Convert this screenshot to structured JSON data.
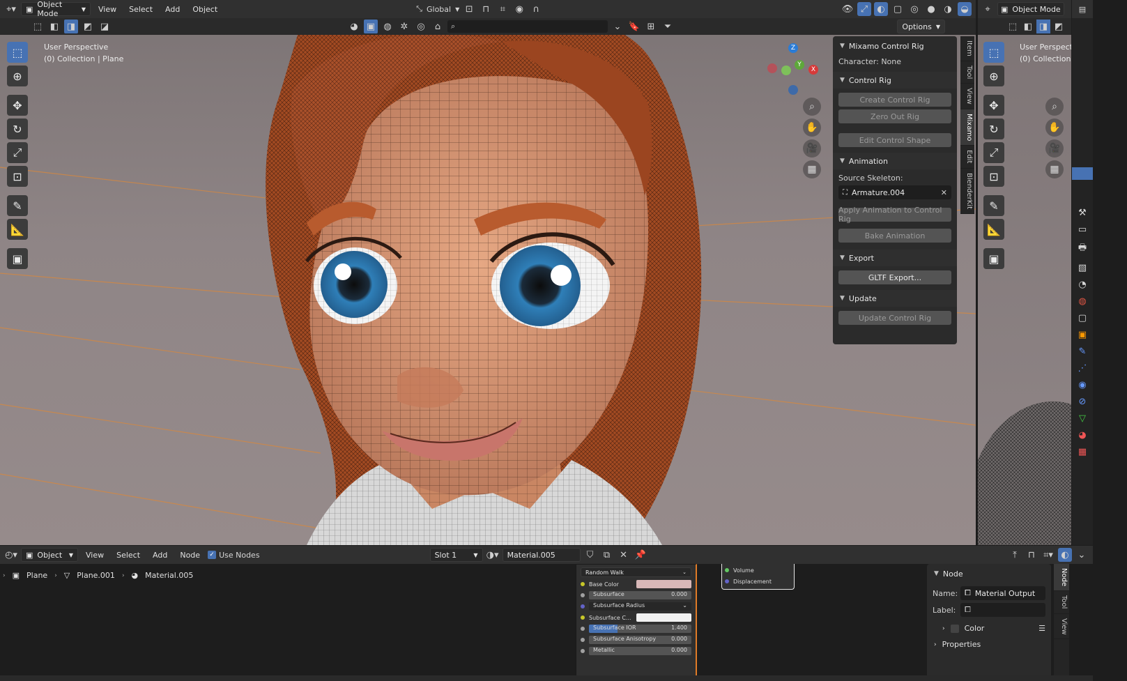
{
  "top_header": {
    "mode": "Object Mode",
    "menus": [
      "View",
      "Select",
      "Add",
      "Object"
    ],
    "orientation": "Global",
    "options": "Options"
  },
  "viewport": {
    "perspective": "User Perspective",
    "collection": "(0) Collection | Plane",
    "gizmo_axes": [
      "X",
      "Y",
      "Z"
    ]
  },
  "side_tabs": [
    "Item",
    "Tool",
    "View",
    "Mixamo",
    "Edit",
    "BlenderKit"
  ],
  "mixamo_panel": {
    "title": "Mixamo Control Rig",
    "character": "Character: None",
    "control_rig_label": "Control Rig",
    "create_control_rig": "Create Control Rig",
    "zero_out_rig": "Zero Out Rig",
    "edit_control_shape": "Edit Control Shape",
    "animation_label": "Animation",
    "source_skeleton_label": "Source Skeleton:",
    "source_skeleton_value": "Armature.004",
    "apply_animation": "Apply Animation to Control Rig",
    "bake_animation": "Bake Animation",
    "export_label": "Export",
    "gltf_export": "GLTF Export...",
    "update_label": "Update",
    "update_control_rig": "Update Control Rig"
  },
  "right_view": {
    "mode": "Object Mode",
    "perspective": "User Perspecti",
    "collection": "(0) Collection |"
  },
  "node_header": {
    "type": "Object",
    "menus": [
      "View",
      "Select",
      "Add",
      "Node"
    ],
    "use_nodes": "Use Nodes",
    "slot": "Slot 1",
    "material": "Material.005"
  },
  "breadcrumb": {
    "object": "Plane",
    "mesh": "Plane.001",
    "material": "Material.005"
  },
  "bsdf_node": {
    "method": "Random Walk",
    "base_color": "Base Color",
    "subsurface": "Subsurface",
    "subsurface_value": "0.000",
    "subsurface_radius": "Subsurface Radius",
    "subsurface_color": "Subsurface C...",
    "subsurface_ior": "Subsurface IOR",
    "subsurface_ior_value": "1.400",
    "subsurface_anisotropy": "Subsurface Anisotropy",
    "subsurface_anisotropy_value": "0.000",
    "metallic": "Metallic",
    "metallic_value": "0.000"
  },
  "output_node": {
    "volume": "Volume",
    "displacement": "Displacement"
  },
  "node_side_panel": {
    "section": "Node",
    "name_label": "Name:",
    "name_value": "Material Output",
    "label_label": "Label:",
    "color_label": "Color",
    "properties_label": "Properties",
    "tabs": [
      "Node",
      "Tool",
      "View"
    ]
  },
  "colors": {
    "accent": "#4772b3",
    "header": "#303030",
    "panel": "#2b2b2b",
    "viewport_bg": "#8e8585",
    "skin": "#d7926e",
    "hair": "#a24a22",
    "iris": "#3f8dc3"
  }
}
